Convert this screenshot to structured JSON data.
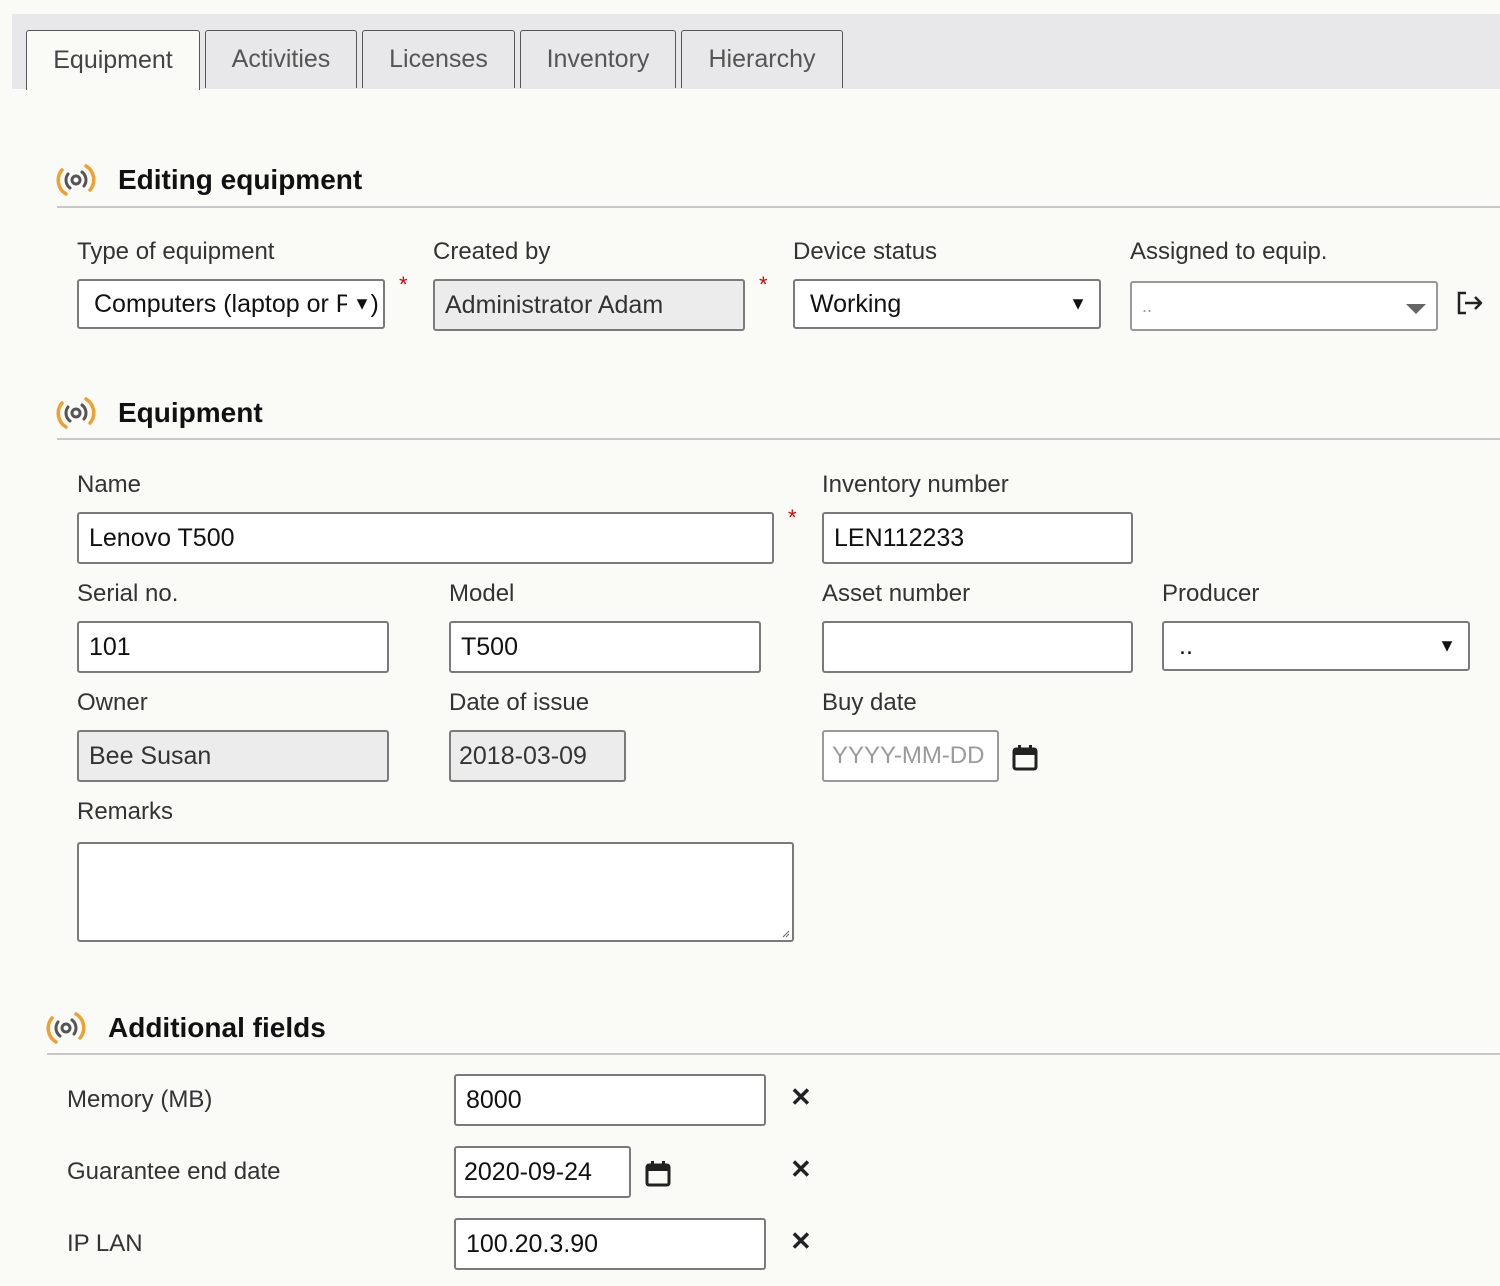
{
  "tabs": [
    {
      "label": "Equipment",
      "active": true
    },
    {
      "label": "Activities",
      "active": false
    },
    {
      "label": "Licenses",
      "active": false
    },
    {
      "label": "Inventory",
      "active": false
    },
    {
      "label": "Hierarchy",
      "active": false
    }
  ],
  "editing": {
    "title": "Editing equipment",
    "type_label": "Type of equipment",
    "type_value": "Computers (laptop or PC)",
    "created_label": "Created by",
    "created_value": "Administrator Adam",
    "status_label": "Device status",
    "status_value": "Working",
    "assigned_label": "Assigned to equip.",
    "assigned_value": ".."
  },
  "equipment": {
    "title": "Equipment",
    "name_label": "Name",
    "name_value": "Lenovo T500",
    "inventory_label": "Inventory number",
    "inventory_value": "LEN112233",
    "serial_label": "Serial no.",
    "serial_value": "101",
    "model_label": "Model",
    "model_value": "T500",
    "asset_label": "Asset number",
    "asset_value": "",
    "producer_label": "Producer",
    "producer_value": "..",
    "owner_label": "Owner",
    "owner_value": "Bee Susan",
    "issue_label": "Date of issue",
    "issue_value": "2018-03-09",
    "buy_label": "Buy date",
    "buy_placeholder": "YYYY-MM-DD",
    "remarks_label": "Remarks",
    "remarks_value": ""
  },
  "additional": {
    "title": "Additional fields",
    "fields": [
      {
        "label": "Memory (MB)",
        "value": "8000"
      },
      {
        "label": "Guarantee end date",
        "value": "2020-09-24"
      },
      {
        "label": "IP LAN",
        "value": "100.20.3.90"
      }
    ]
  },
  "symbols": {
    "required": "*",
    "caret": "▼",
    "remove": "✕"
  },
  "icons": {
    "section": "signal-icon",
    "calendar": "calendar-icon",
    "goto": "sign-out-icon"
  },
  "colors": {
    "section_icon_orange": "#f0a030",
    "section_icon_dark": "#555555",
    "required": "#dd0000"
  }
}
